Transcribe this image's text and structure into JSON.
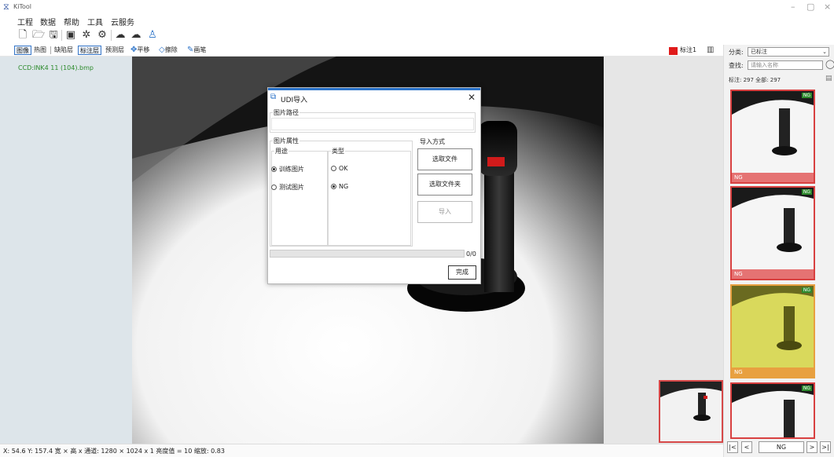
{
  "app": {
    "title": "KiTool"
  },
  "window": {
    "minimize": "–",
    "maximize": "▢",
    "close": "×"
  },
  "menu": [
    "工程",
    "数据",
    "帮助",
    "工具",
    "云服务"
  ],
  "ribbon": {
    "buttons": [
      "图像",
      "热图",
      "缺陷层",
      "标注层",
      "预测层"
    ],
    "move": "平移",
    "erase": "擦除",
    "brush": "画笔",
    "label_tag": "标注1"
  },
  "left": {
    "filename": "CCD:INK4 11 (104).bmp"
  },
  "status": {
    "text": "X: 54.6 Y: 157.4  宽 × 高 x 通道: 1280 × 1024 x 1  亮度值 = 10  缩放: 0.83"
  },
  "sidebar": {
    "class_label": "分类:",
    "class_value": "已标注",
    "query_label": "查找:",
    "query_placeholder": "请输入名称",
    "stats": "标注: 297  全部: 297"
  },
  "thumbs": [
    {
      "tag": "NG",
      "foot": "NG",
      "foot_color": "#e57373"
    },
    {
      "tag": "NG",
      "foot": "NG",
      "foot_color": "#e57373"
    },
    {
      "tag": "NG",
      "foot": "NG",
      "foot_color": "#e8a040"
    },
    {
      "tag": "NG",
      "foot": "",
      "foot_color": "#e57373"
    }
  ],
  "pager": {
    "first": "|<",
    "prev": "<",
    "value": "NG",
    "next": ">",
    "last": ">|"
  },
  "dialog": {
    "title": "UDI导入",
    "path_group": "图片路径",
    "attr_group": "图片属性",
    "use_label": "用途",
    "type_label": "类型",
    "use_options": [
      "训练图片",
      "测试图片"
    ],
    "type_options": [
      "OK",
      "NG"
    ],
    "import_group": "导入方式",
    "btn_file": "选取文件",
    "btn_folder": "选取文件夹",
    "btn_import": "导入",
    "progress": "0/0",
    "done": "完成"
  }
}
